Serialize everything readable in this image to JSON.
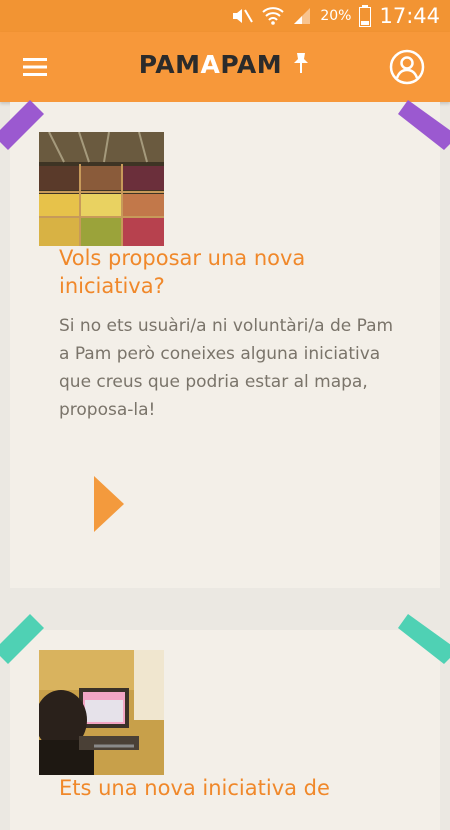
{
  "status_bar": {
    "battery_percent": "20%",
    "time": "17:44",
    "icons": [
      "mute-icon",
      "wifi-icon",
      "signal-icon",
      "battery-icon"
    ]
  },
  "app_bar": {
    "logo_part1": "PAM",
    "logo_part2": "A",
    "logo_part3": "PAM",
    "icons": [
      "menu-icon",
      "pin-icon",
      "profile-icon"
    ]
  },
  "cards": [
    {
      "title": "Vols proposar una nova iniciativa?",
      "body": "Si no ets usuàri/a ni voluntàri/a de Pam a Pam però coneixes alguna iniciativa que creus que podria estar al mapa, proposa-la!",
      "tape_color": "#9b59d0",
      "image": "fruit-market-photo"
    },
    {
      "title": "Ets una nova iniciativa de",
      "tape_color": "#4fd1b4",
      "image": "person-at-computer-photo"
    }
  ],
  "colors": {
    "primary": "#f7983a",
    "title": "#f0882a",
    "body_text": "#7a746a",
    "card_bg": "#f3efe8",
    "page_bg": "#ebe8e2"
  }
}
